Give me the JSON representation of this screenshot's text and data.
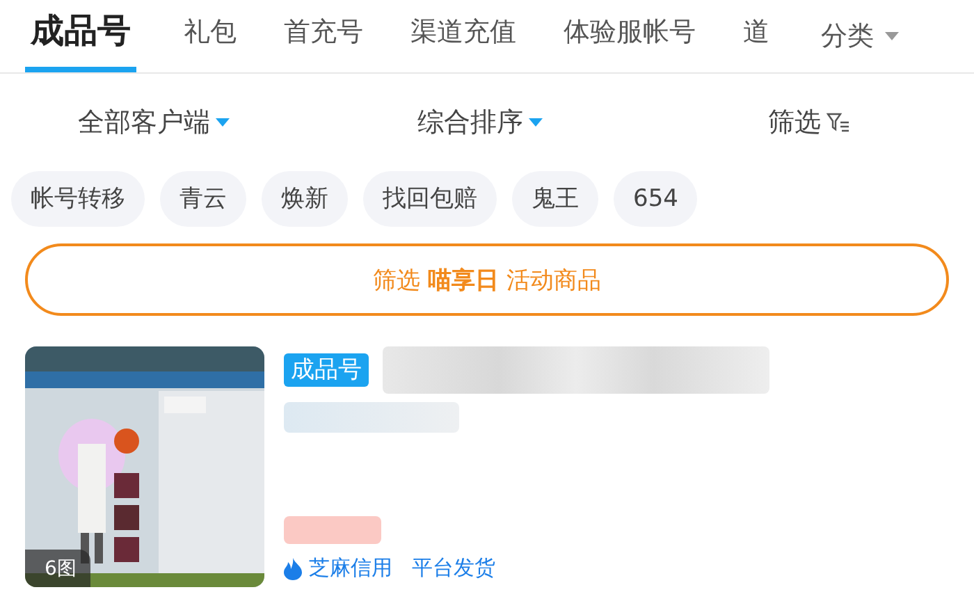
{
  "tabs": [
    {
      "label": "成品号",
      "selected": true
    },
    {
      "label": "礼包",
      "selected": false
    },
    {
      "label": "首充号",
      "selected": false
    },
    {
      "label": "渠道充值",
      "selected": false
    },
    {
      "label": "体验服帐号",
      "selected": false
    },
    {
      "label": "道",
      "selected": false
    }
  ],
  "category_menu": {
    "label": "分类"
  },
  "filters": [
    {
      "label": "全部客户端",
      "kind": "dropdown"
    },
    {
      "label": "综合排序",
      "kind": "dropdown"
    },
    {
      "label": "筛选",
      "kind": "filter"
    }
  ],
  "tags": [
    "帐号转移",
    "青云",
    "焕新",
    "找回包赔",
    "鬼王",
    "654"
  ],
  "promo_banner": {
    "text": "筛选 **喵享日** 活动商品"
  },
  "listings": [
    {
      "image": {
        "kind": "picture",
        "count_badge": "6图"
      },
      "badge": "成品号",
      "services": [
        "芝麻信用",
        "平台发货"
      ]
    }
  ]
}
